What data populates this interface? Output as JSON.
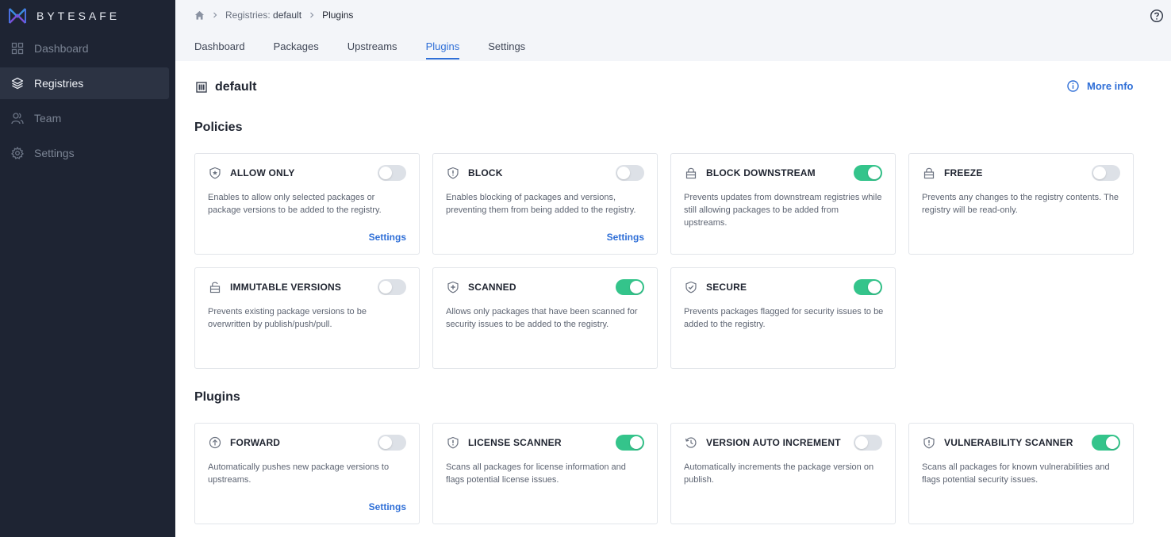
{
  "brand": {
    "name": "BYTESAFE"
  },
  "sidebar": {
    "items": [
      {
        "label": "Dashboard",
        "icon": "grid-icon"
      },
      {
        "label": "Registries",
        "icon": "layers-icon"
      },
      {
        "label": "Team",
        "icon": "users-icon"
      },
      {
        "label": "Settings",
        "icon": "gear-icon"
      }
    ]
  },
  "breadcrumb": {
    "registries_label": "Registries:",
    "registry_name": "default",
    "current": "Plugins"
  },
  "tabs": [
    "Dashboard",
    "Packages",
    "Upstreams",
    "Plugins",
    "Settings"
  ],
  "registry": {
    "name": "default"
  },
  "more_info": "More info",
  "sections": {
    "policies": "Policies",
    "plugins": "Plugins"
  },
  "policies": [
    {
      "title": "ALLOW ONLY",
      "icon": "shield-star-icon",
      "enabled": false,
      "description": "Enables to allow only selected packages or package versions to be added to the registry.",
      "settings": "Settings"
    },
    {
      "title": "BLOCK",
      "icon": "shield-alert-icon",
      "enabled": false,
      "description": "Enables blocking of packages and versions, preventing them from being added to the registry.",
      "settings": "Settings"
    },
    {
      "title": "BLOCK DOWNSTREAM",
      "icon": "lock-icon",
      "enabled": true,
      "description": "Prevents updates from downstream registries while still allowing packages to be added from upstreams.",
      "settings": ""
    },
    {
      "title": "FREEZE",
      "icon": "lock-icon",
      "enabled": false,
      "description": "Prevents any changes to the registry contents. The registry will be read-only.",
      "settings": ""
    },
    {
      "title": "IMMUTABLE VERSIONS",
      "icon": "lock-open-icon",
      "enabled": false,
      "description": "Prevents existing package versions to be overwritten by publish/push/pull.",
      "settings": ""
    },
    {
      "title": "SCANNED",
      "icon": "shield-plus-icon",
      "enabled": true,
      "description": "Allows only packages that have been scanned for security issues to be added to the registry.",
      "settings": ""
    },
    {
      "title": "SECURE",
      "icon": "shield-check-icon",
      "enabled": true,
      "description": "Prevents packages flagged for security issues to be added to the registry.",
      "settings": ""
    }
  ],
  "plugins": [
    {
      "title": "FORWARD",
      "icon": "arrow-up-circle-icon",
      "enabled": false,
      "description": "Automatically pushes new package versions to upstreams.",
      "settings": "Settings"
    },
    {
      "title": "LICENSE SCANNER",
      "icon": "shield-alert-icon",
      "enabled": true,
      "description": "Scans all packages for license information and flags potential license issues.",
      "settings": ""
    },
    {
      "title": "VERSION AUTO INCREMENT",
      "icon": "history-icon",
      "enabled": false,
      "description": "Automatically increments the package version on publish.",
      "settings": ""
    },
    {
      "title": "VULNERABILITY SCANNER",
      "icon": "shield-alert-icon",
      "enabled": true,
      "description": "Scans all packages for known vulnerabilities and flags potential security issues.",
      "settings": ""
    }
  ],
  "colors": {
    "accent": "#2f6fd7",
    "toggle_on": "#34c48b",
    "sidebar_bg": "#1e2433"
  }
}
